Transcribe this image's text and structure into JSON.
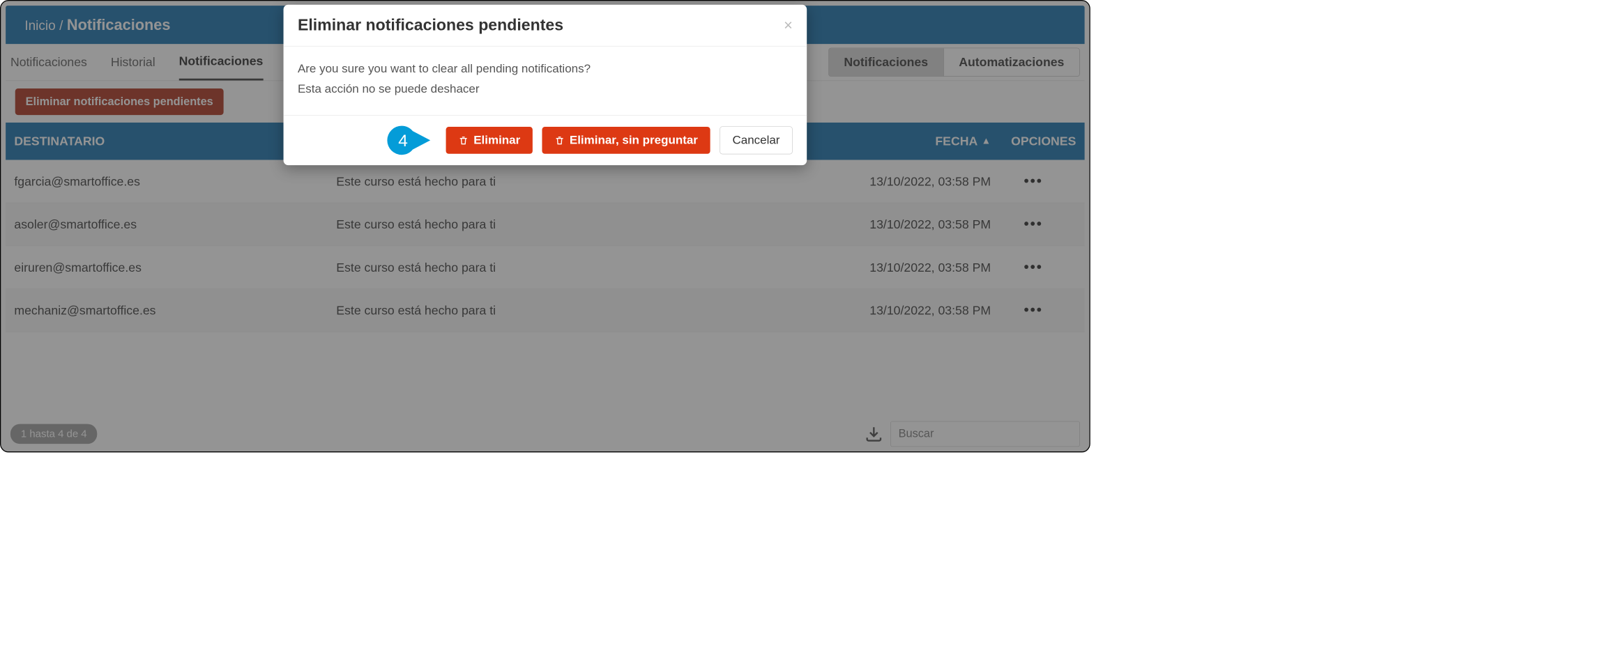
{
  "breadcrumb": {
    "home": "Inicio",
    "sep": "/",
    "current": "Notificaciones"
  },
  "tabs": {
    "left": [
      "Notificaciones",
      "Historial",
      "Notificaciones"
    ],
    "active_index": 2,
    "right": [
      "Notificaciones",
      "Automatizaciones"
    ],
    "right_active_index": 0
  },
  "actions": {
    "delete_pending": "Eliminar notificaciones pendientes"
  },
  "table": {
    "headers": {
      "recipient": "DESTINATARIO",
      "subject": "",
      "date": "FECHA",
      "options": "OPCIONES"
    },
    "rows": [
      {
        "recipient": "fgarcia@smartoffice.es",
        "subject": "Este curso está hecho para ti",
        "date": "13/10/2022, 03:58 PM"
      },
      {
        "recipient": "asoler@smartoffice.es",
        "subject": "Este curso está hecho para ti",
        "date": "13/10/2022, 03:58 PM"
      },
      {
        "recipient": "eiruren@smartoffice.es",
        "subject": "Este curso está hecho para ti",
        "date": "13/10/2022, 03:58 PM"
      },
      {
        "recipient": "mechaniz@smartoffice.es",
        "subject": "Este curso está hecho para ti",
        "date": "13/10/2022, 03:58 PM"
      }
    ]
  },
  "footer": {
    "pagination": "1 hasta 4 de 4",
    "search_placeholder": "Buscar"
  },
  "modal": {
    "title": "Eliminar notificaciones pendientes",
    "body_line1": "Are you sure you want to clear all pending notifications?",
    "body_line2": "Esta acción no se puede deshacer",
    "btn_delete": "Eliminar",
    "btn_delete_noask": "Eliminar, sin preguntar",
    "btn_cancel": "Cancelar",
    "callout_number": "4"
  }
}
